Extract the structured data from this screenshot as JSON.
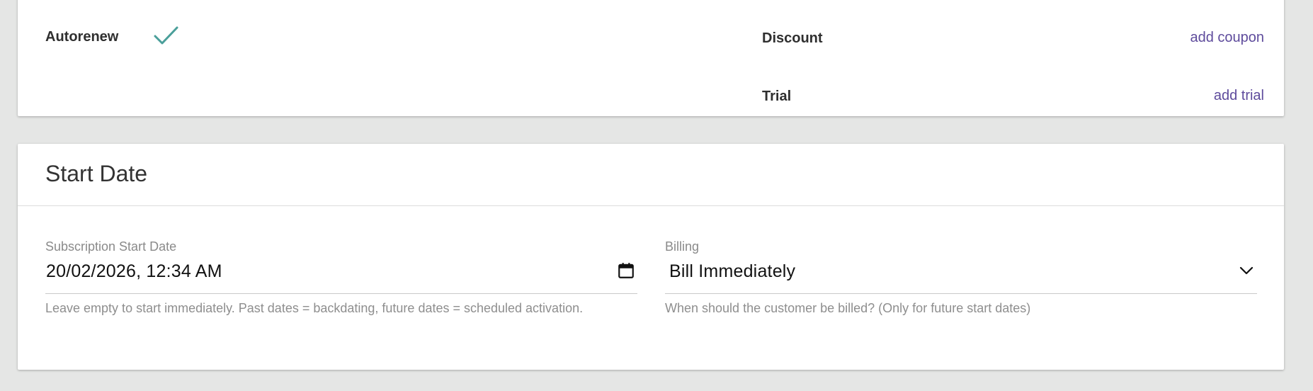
{
  "options": {
    "autorenew_label": "Autorenew",
    "autorenew_checked": true,
    "discount_label": "Discount",
    "add_coupon_link": "add coupon",
    "trial_label": "Trial",
    "add_trial_link": "add trial"
  },
  "start_date": {
    "title": "Start Date",
    "subscription_start": {
      "label": "Subscription Start Date",
      "value": "20/02/2026, 12:34 AM",
      "help": "Leave empty to start immediately. Past dates = backdating, future dates = scheduled activation."
    },
    "billing": {
      "label": "Billing",
      "selected": "Bill Immediately",
      "help": "When should the customer be billed? (Only for future start dates)"
    }
  },
  "colors": {
    "accent_link": "#5e4b9c",
    "check": "#4a9f9a",
    "background": "#e5e6e5"
  }
}
